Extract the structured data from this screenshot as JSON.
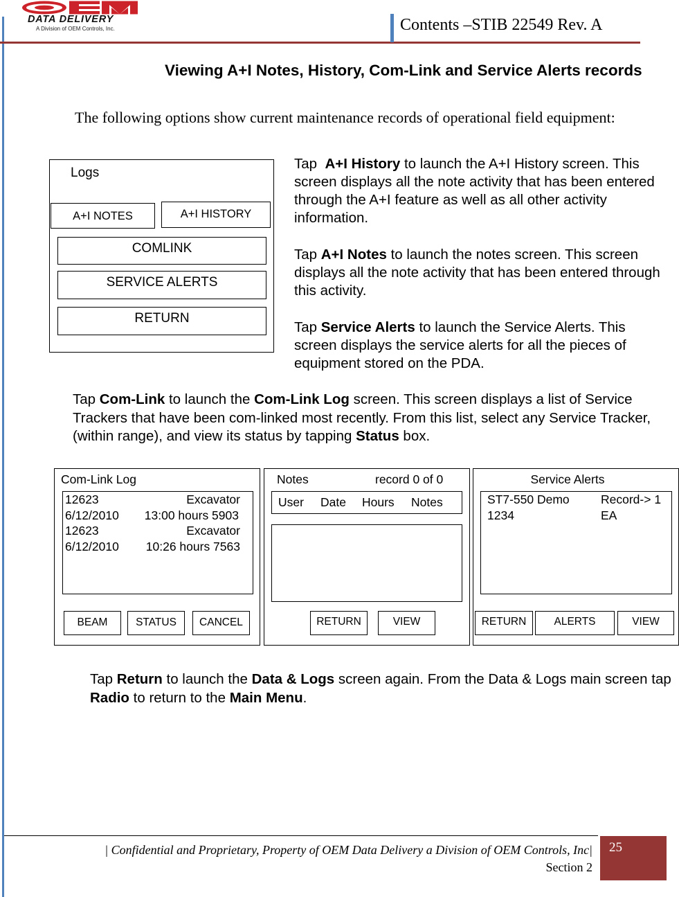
{
  "header": {
    "doc_title": "Contents –STIB 22549 Rev. A",
    "logo": {
      "wordmark": "OEM",
      "tagline": "DATA DELIVERY",
      "subtitle": "A Division of OEM Controls, Inc."
    },
    "colors": {
      "accent_red": "#943634",
      "accent_blue": "#4f81bd",
      "logo_red": "#cc2229"
    }
  },
  "section": {
    "heading": "Viewing A+I Notes, History, Com-Link and Service Alerts records",
    "intro": "The following options show current maintenance records of operational field equipment:"
  },
  "logs_screen": {
    "title": "Logs",
    "buttons": {
      "ai_notes": "A+I NOTES",
      "ai_history": "A+I HISTORY",
      "comlink": "COMLINK",
      "service_alerts": "SERVICE ALERTS",
      "return": "RETURN"
    }
  },
  "paragraphs": {
    "history": {
      "pre": "Tap  ",
      "bold": "A+I History",
      "post": " to launch the A+I History screen. This screen displays all the note activity that has been entered through the A+I feature as well as all other activity information."
    },
    "notes": {
      "pre": "Tap ",
      "bold": "A+I Notes",
      "post": " to launch the notes screen. This screen displays all the note activity that has been entered through this activity."
    },
    "alerts": {
      "pre": "Tap ",
      "bold": "Service Alerts",
      "post": " to launch the Service Alerts. This screen displays the service alerts for all the pieces of  equipment stored on the PDA."
    },
    "comlink": {
      "t1": "Tap ",
      "b1": "Com-Link",
      "t2": " to launch the ",
      "b2": "Com-Link Log",
      "t3": "  screen.  This screen displays a list of Service Trackers  that have been com-linked most recently.  From this list, select any Service Tracker, (within range), and view its status by tapping ",
      "b3": "Status",
      "t4": " box."
    },
    "return": {
      "t1": "Tap ",
      "b1": "Return",
      "t2": "  to launch the ",
      "b2": "Data & Logs",
      "t3": "  screen again.  From the Data & Logs main screen  tap ",
      "b3": "Radio",
      "t4": " to return to the ",
      "b4": "Main Menu",
      "t5": "."
    }
  },
  "comlink_screen": {
    "title": "Com-Link Log",
    "records": [
      {
        "id": "12623",
        "type": "Excavator",
        "date": "6/12/2010",
        "time_hours": "13:00 hours 5903"
      },
      {
        "id": "12623",
        "type": "Excavator",
        "date": "6/12/2010",
        "time_hours": "10:26 hours 7563"
      }
    ],
    "buttons": {
      "beam": "BEAM",
      "status": "STATUS",
      "cancel": "CANCEL"
    }
  },
  "notes_screen": {
    "title": "Notes",
    "record_counter": "record 0 of 0",
    "columns": [
      "User",
      "Date",
      "Hours",
      "Notes"
    ],
    "rows": [],
    "buttons": {
      "return": "RETURN",
      "view": "VIEW"
    }
  },
  "alerts_screen": {
    "title": "Service Alerts",
    "records": [
      {
        "left": "ST7-550 Demo",
        "right": "Record-> 1"
      },
      {
        "left": "1234",
        "right": "EA"
      }
    ],
    "buttons": {
      "return": "RETURN",
      "alerts": "ALERTS",
      "view": "VIEW"
    }
  },
  "footer": {
    "confidential": "| Confidential and Proprietary, Property of OEM Data Delivery a Division of OEM Controls, Inc|",
    "section": "Section 2",
    "page_number": "25"
  }
}
